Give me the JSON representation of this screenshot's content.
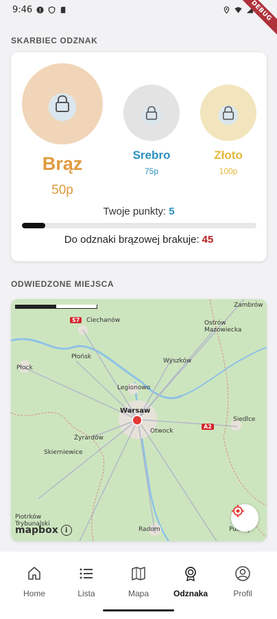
{
  "status": {
    "time": "9:46",
    "debug_label": "DEBUG"
  },
  "badges_section": {
    "title": "SKARBIEC ODZNAK",
    "medals": [
      {
        "name": "Brąz",
        "points": "50p",
        "color": "#e09a3e"
      },
      {
        "name": "Srebro",
        "points": "75p",
        "color": "#2a8fbd"
      },
      {
        "name": "Złoto",
        "points": "100p",
        "color": "#e3b83a"
      }
    ],
    "your_points_label": "Twoje punkty:",
    "your_points_value": "5",
    "progress_fraction": 0.1,
    "missing_label": "Do odznaki brązowej brakuje:",
    "missing_value": "45"
  },
  "places_section": {
    "title": "ODWIEDZONE MIEJSCA",
    "map": {
      "labels": [
        "Zambrów",
        "Ciechanów",
        "Ostrów Mazowiecka",
        "Płock",
        "Płońsk",
        "Wyszków",
        "Legionowo",
        "Warsaw",
        "Siedlce",
        "Otwock",
        "Żyrardów",
        "Skierniewice",
        "Piotrków Trybunalski",
        "Radom",
        "Puławy"
      ],
      "road_badges": [
        "S7",
        "A2"
      ],
      "attribution": "mapbox",
      "info_icon": "info-icon"
    }
  },
  "nav": {
    "items": [
      {
        "label": "Home",
        "icon": "home-icon",
        "active": false
      },
      {
        "label": "Lista",
        "icon": "list-icon",
        "active": false
      },
      {
        "label": "Mapa",
        "icon": "map-icon",
        "active": false
      },
      {
        "label": "Odznaka",
        "icon": "badge-icon",
        "active": true
      },
      {
        "label": "Profil",
        "icon": "profile-icon",
        "active": false
      }
    ]
  }
}
